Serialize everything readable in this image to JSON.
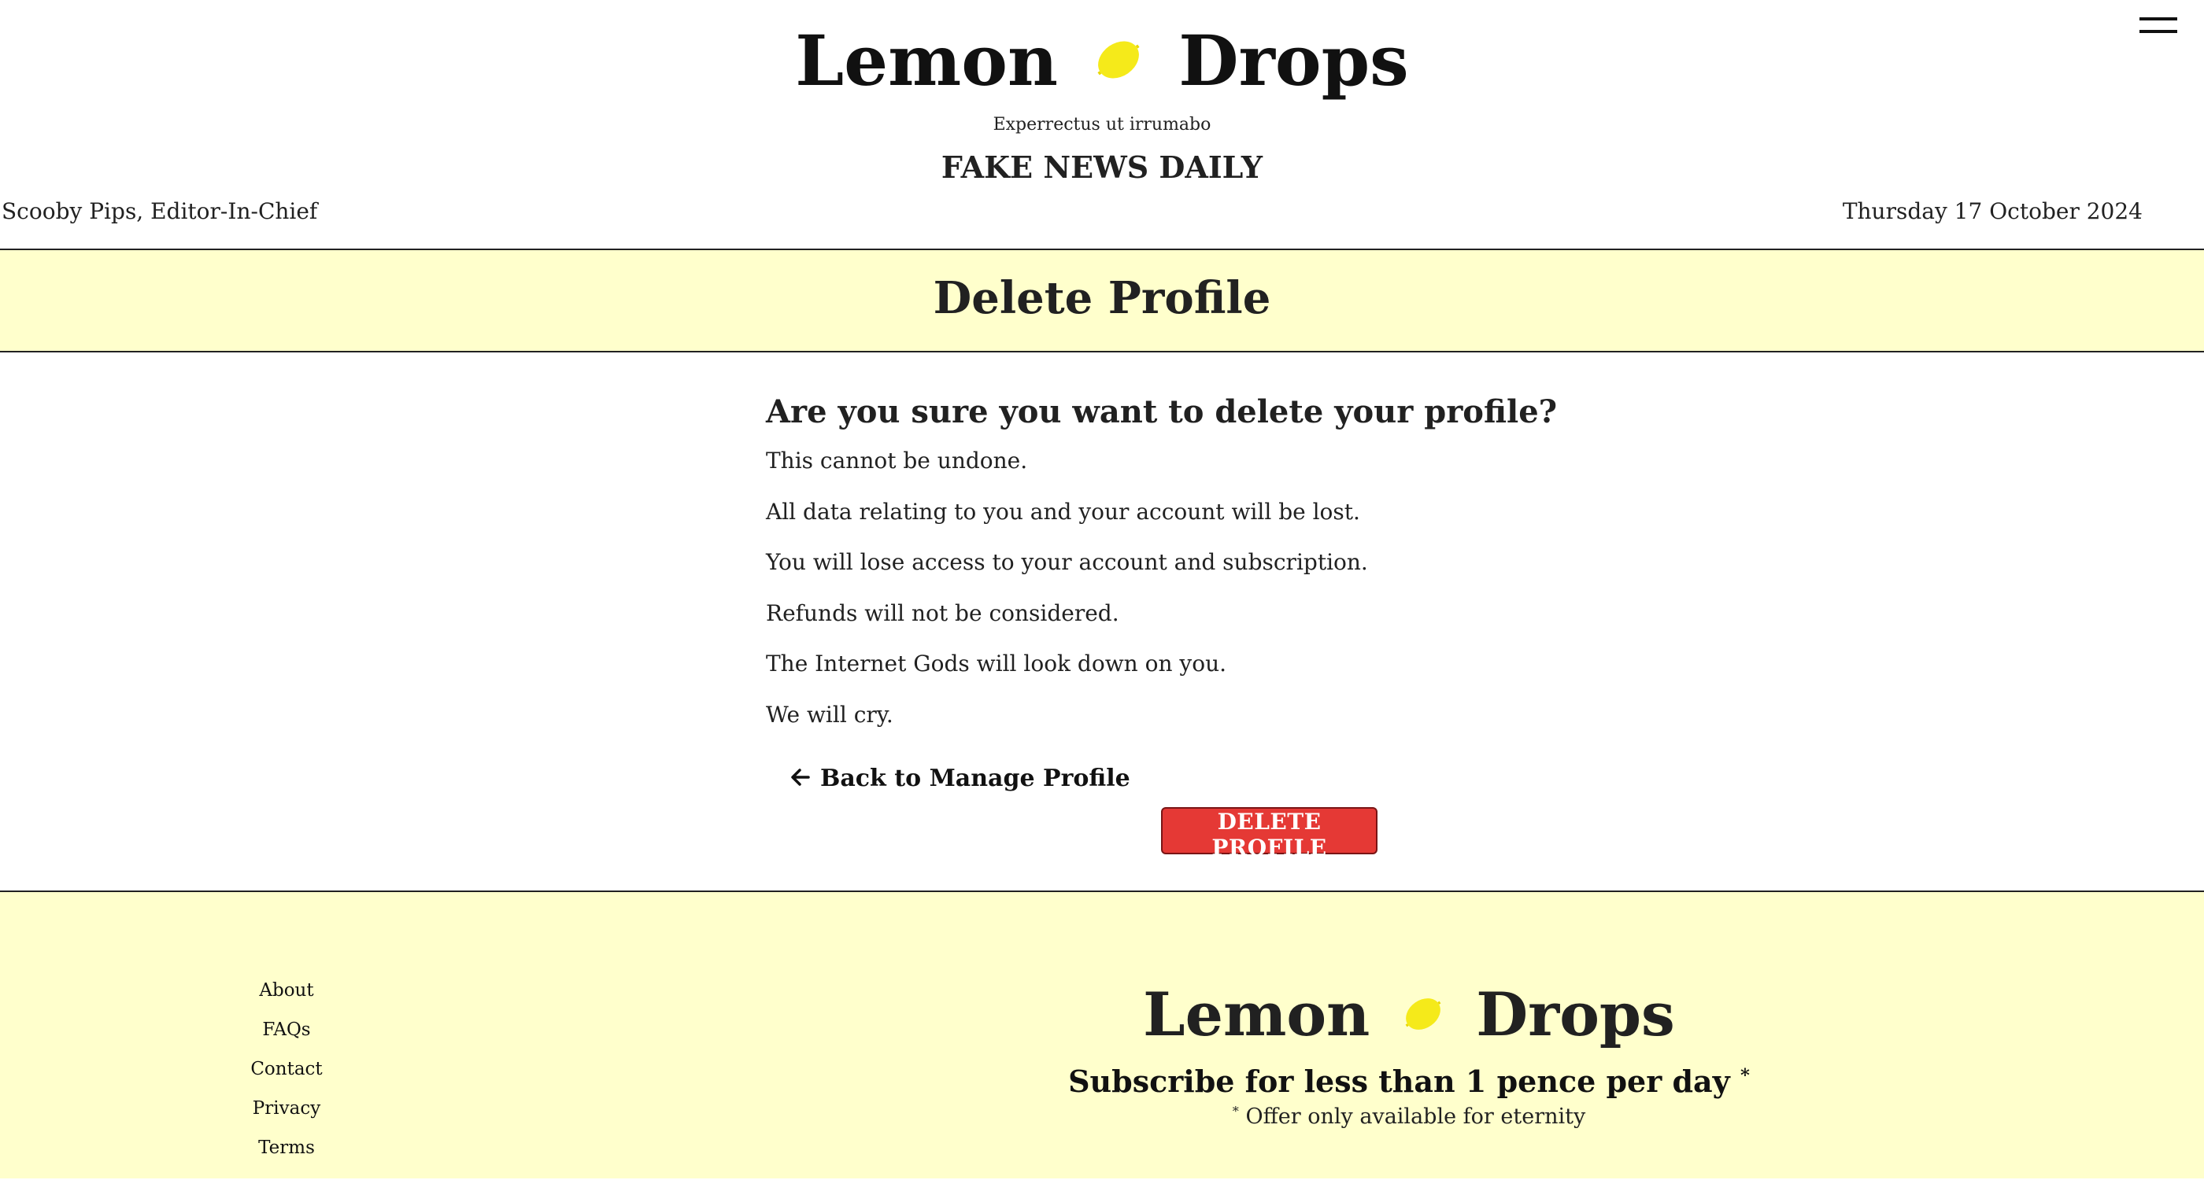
{
  "header": {
    "brand_left": "Lemon",
    "brand_right": "Drops",
    "brand_icon": "lemon-icon",
    "tagline": "Experrectus ut irrumabo",
    "paper_name": "FAKE NEWS DAILY",
    "editor": "Scooby Pips, Editor-In-Chief",
    "date": "Thursday 17 October 2024",
    "menu_icon": "hamburger-menu-icon"
  },
  "page": {
    "title": "Delete Profile"
  },
  "main": {
    "question": "Are you sure you want to delete your profile?",
    "warnings": [
      "This cannot be undone.",
      "All data relating to you and your account will be lost.",
      "You will lose access to your account and subscription.",
      "Refunds will not be considered.",
      "The Internet Gods will look down on you.",
      "We will cry."
    ],
    "back_link": "Back to Manage Profile",
    "back_icon": "arrow-left-icon",
    "delete_button": "DELETE PROFILE"
  },
  "footer": {
    "links": [
      "About",
      "FAQs",
      "Contact",
      "Privacy",
      "Terms"
    ],
    "brand_left": "Lemon",
    "brand_right": "Drops",
    "subscribe": "Subscribe for less than 1 pence per day",
    "subscribe_mark": "*",
    "offer_mark": "*",
    "offer": "Offer only available for eternity"
  },
  "colors": {
    "band_background": "#ffffcc",
    "lemon": "#f5ea1a",
    "delete_button": "#e53935",
    "text": "#212121"
  }
}
